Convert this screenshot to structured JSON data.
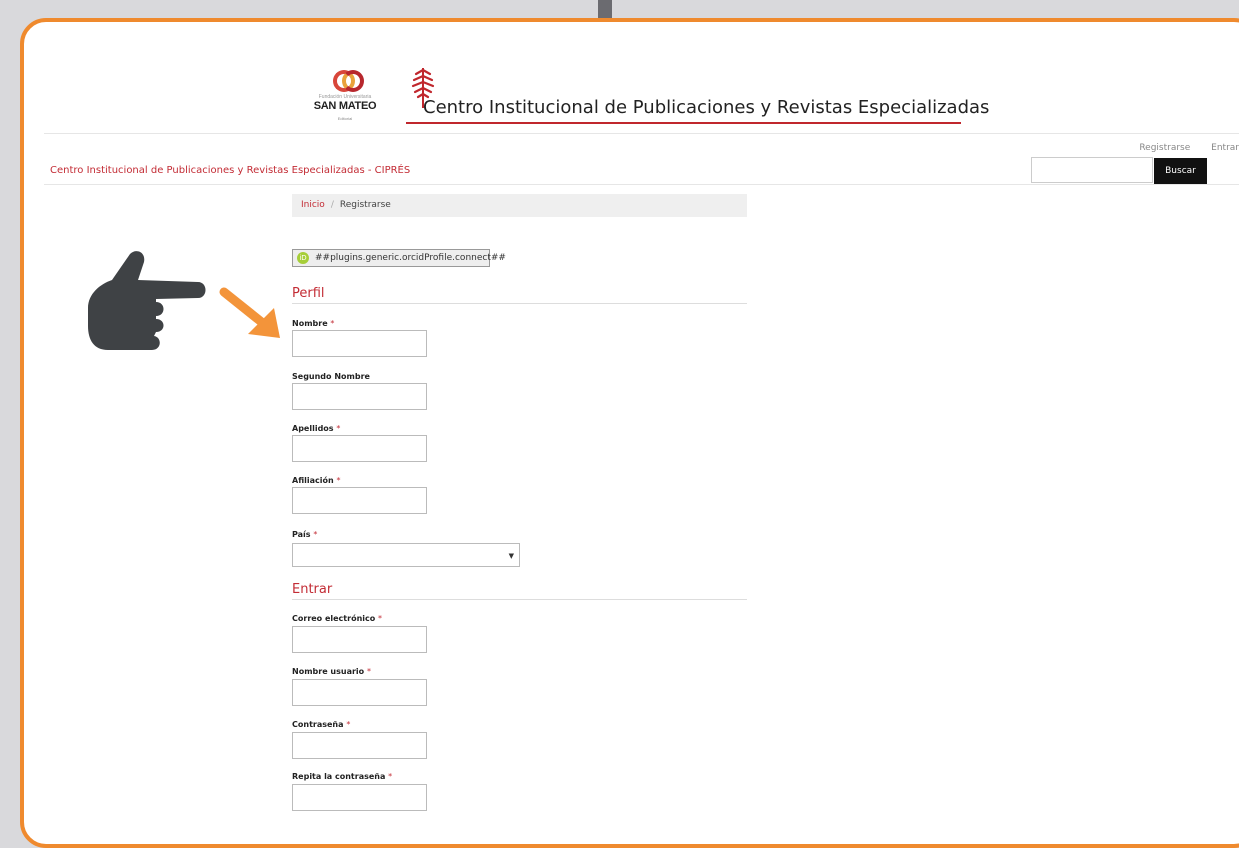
{
  "banner": {
    "logo_small_top": "Fundación Universitaria",
    "logo_name": "SAN MATEO",
    "logo_sub": "Editorial",
    "title": "Centro Institucional de Publicaciones y Revistas Especializadas"
  },
  "header": {
    "site_title": "Centro Institucional de Publicaciones y Revistas Especializadas - CIPRÉS",
    "register_link": "Registrarse",
    "login_link": "Entrar",
    "search_button": "Buscar",
    "search_value": ""
  },
  "breadcrumb": {
    "home": "Inicio",
    "separator": "/",
    "current": "Registrarse"
  },
  "orcid": {
    "icon_text": "iD",
    "label": "##plugins.generic.orcidProfile.connect##"
  },
  "profile_section": {
    "heading": "Perfil",
    "fields": {
      "first_name": {
        "label": "Nombre",
        "required": "*",
        "value": ""
      },
      "middle_name": {
        "label": "Segundo Nombre",
        "value": ""
      },
      "last_name": {
        "label": "Apellidos",
        "required": "*",
        "value": ""
      },
      "affiliation": {
        "label": "Afiliación",
        "required": "*",
        "value": ""
      },
      "country": {
        "label": "País",
        "required": "*",
        "selected": "",
        "arrow": "▼"
      }
    }
  },
  "login_section": {
    "heading": "Entrar",
    "fields": {
      "email": {
        "label": "Correo electrónico",
        "required": "*",
        "value": ""
      },
      "username": {
        "label": "Nombre usuario",
        "required": "*",
        "value": ""
      },
      "password": {
        "label": "Contraseña",
        "required": "*",
        "value": ""
      },
      "password_repeat": {
        "label": "Repita la contraseña",
        "required": "*",
        "value": ""
      }
    }
  },
  "colors": {
    "frame": "#ef8a2e",
    "accent": "#c32c35",
    "hand": "#3f4245",
    "pointer_arrow": "#f3943a",
    "orcid": "#a6ce39"
  },
  "icons": {
    "hand": "pointing-hand-icon",
    "arrow": "orange-arrow-icon",
    "orcid": "orcid-icon",
    "select": "chevron-down-icon",
    "tree": "tree-logo-icon"
  }
}
